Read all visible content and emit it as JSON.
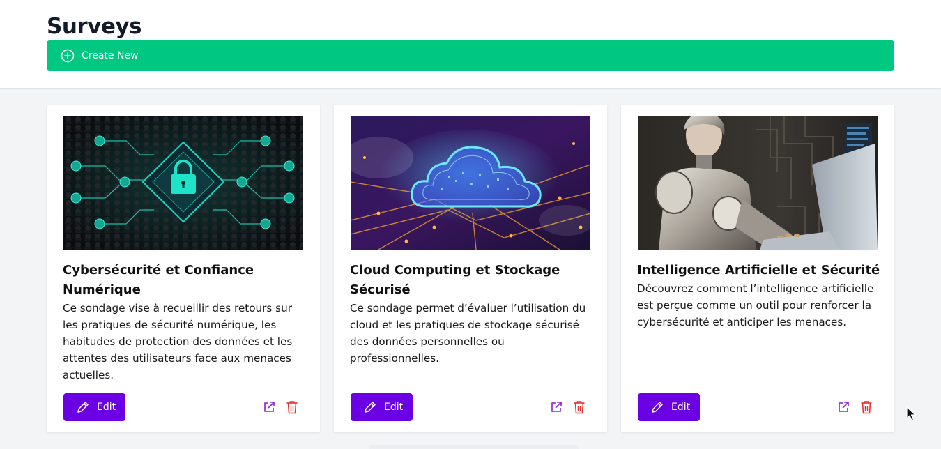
{
  "header": {
    "title": "Surveys",
    "create_label": "Create New"
  },
  "colors": {
    "create": "#00c781",
    "edit": "#6b00e5",
    "open_icon": "#8a1fd6",
    "delete_icon": "#e03131",
    "title": "#131a2a"
  },
  "cards": [
    {
      "image": "cybersecurity-lock-network-image",
      "title": "Cybersécurité et Confiance Numérique",
      "description": "Ce sondage vise à recueillir des retours sur les pratiques de sécurité numérique, les habitudes de protection des données et les attentes des utilisateurs face aux menaces actuelles.",
      "edit_label": "Edit"
    },
    {
      "image": "cloud-circuit-board-image",
      "title": "Cloud Computing et Stockage Sécurisé",
      "description": "Ce sondage permet d’évaluer l’utilisation du cloud et les pratiques de stockage sécurisé des données personnelles ou professionnelles.",
      "edit_label": "Edit"
    },
    {
      "image": "robot-woman-laptop-image",
      "title": "Intelligence Artificielle et Sécurité",
      "description": "Découvrez comment l’intelligence artificielle est perçue comme un outil pour renforcer la cybersécurité et anticiper les menaces.",
      "edit_label": "Edit"
    }
  ]
}
